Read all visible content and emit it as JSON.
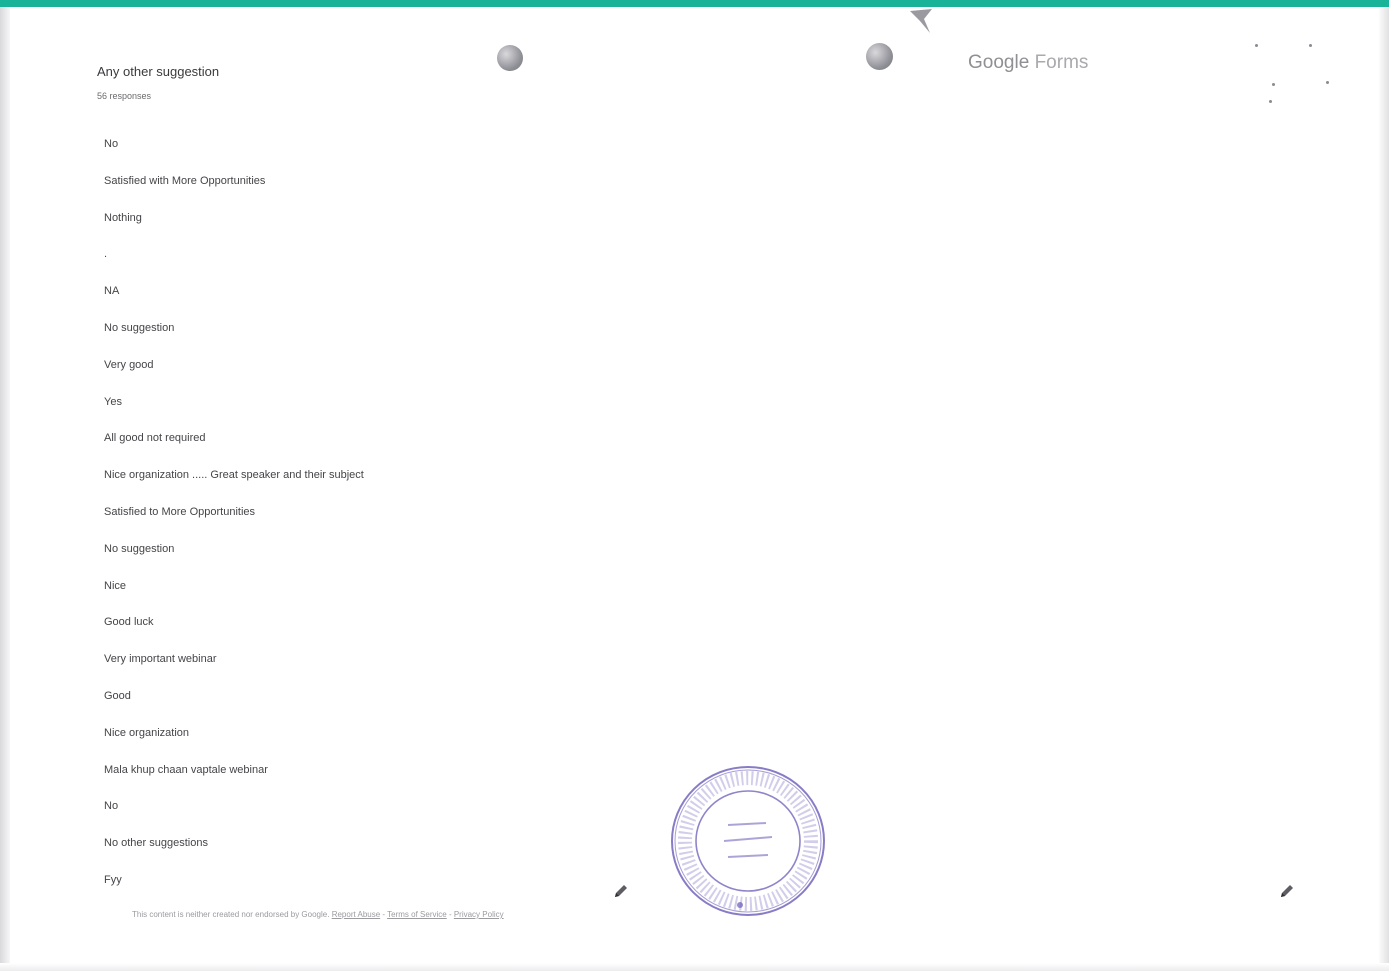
{
  "question": {
    "title": "Any other suggestion",
    "count": "56 responses"
  },
  "responses": [
    "No",
    "Satisfied with More Opportunities",
    "Nothing",
    ".",
    "NA",
    "No suggestion",
    "Very good",
    "Yes",
    "All good not required",
    "Nice organization ..... Great speaker and their subject",
    "Satisfied to More Opportunities",
    "No suggestion",
    "Nice",
    "Good luck",
    "Very important webinar",
    "Good",
    "Nice organization",
    "Mala khup chaan vaptale webinar",
    "No",
    "No other suggestions",
    "Fyy"
  ],
  "brand": {
    "google": "Google",
    "forms": "Forms"
  },
  "footer": {
    "text": "This content is neither created nor endorsed by Google.",
    "report_abuse": "Report Abuse",
    "sep1": " - ",
    "terms": "Terms of Service",
    "sep2": " - ",
    "privacy": "Privacy Policy"
  },
  "colors": {
    "accent_bar": "#19b39a",
    "seal_ink": "#6a5bb8"
  },
  "icons": {
    "edit_left": "pencil-icon",
    "edit_right": "pencil-icon"
  }
}
